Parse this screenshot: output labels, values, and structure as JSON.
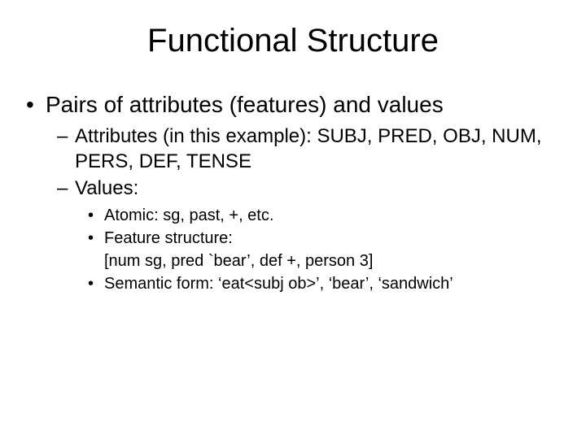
{
  "title": "Functional Structure",
  "bullets": {
    "main": "Pairs of attributes (features) and values",
    "sub1": "Attributes (in this example): SUBJ, PRED, OBJ, NUM, PERS, DEF, TENSE",
    "sub2": "Values:",
    "atomic": "Atomic: sg, past, +, etc.",
    "fs_label": "Feature structure:",
    "fs_example": "[num sg, pred `bear’, def  +, person 3]",
    "semform": "Semantic form: ‘eat<subj ob>’, ‘bear’, ‘sandwich’"
  }
}
